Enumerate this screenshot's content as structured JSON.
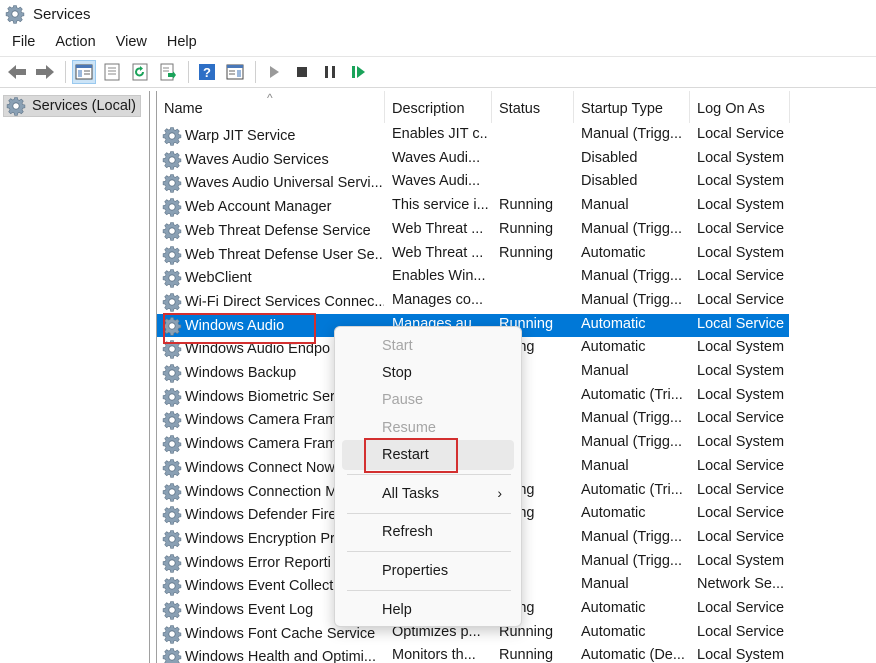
{
  "window": {
    "title": "Services"
  },
  "menu": [
    "File",
    "Action",
    "View",
    "Help"
  ],
  "tree": {
    "root": "Services (Local)"
  },
  "columns": [
    "Name",
    "Description",
    "Status",
    "Startup Type",
    "Log On As"
  ],
  "rows": [
    [
      "Warp JIT Service",
      "Enables JIT c...",
      "",
      "Manual (Trigg...",
      "Local Service"
    ],
    [
      "Waves Audio Services",
      "Waves Audi...",
      "",
      "Disabled",
      "Local System"
    ],
    [
      "Waves Audio Universal Servi...",
      "Waves Audi...",
      "",
      "Disabled",
      "Local System"
    ],
    [
      "Web Account Manager",
      "This service i...",
      "Running",
      "Manual",
      "Local System"
    ],
    [
      "Web Threat Defense Service",
      "Web Threat ...",
      "Running",
      "Manual (Trigg...",
      "Local Service"
    ],
    [
      "Web Threat Defense User Se...",
      "Web Threat ...",
      "Running",
      "Automatic",
      "Local System"
    ],
    [
      "WebClient",
      "Enables Win...",
      "",
      "Manual (Trigg...",
      "Local Service"
    ],
    [
      "Wi-Fi Direct Services Connec...",
      "Manages co...",
      "",
      "Manual (Trigg...",
      "Local Service"
    ],
    [
      "Windows Audio",
      "Manages au...",
      "Running",
      "Automatic",
      "Local Service"
    ],
    [
      "Windows Audio Endpo",
      "",
      "nning",
      "Automatic",
      "Local System"
    ],
    [
      "Windows Backup",
      "",
      "",
      "Manual",
      "Local System"
    ],
    [
      "Windows Biometric Ser",
      "",
      "",
      "Automatic (Tri...",
      "Local System"
    ],
    [
      "Windows Camera Fram",
      "",
      "",
      "Manual (Trigg...",
      "Local Service"
    ],
    [
      "Windows Camera Fram",
      "",
      "",
      "Manual (Trigg...",
      "Local System"
    ],
    [
      "Windows Connect Now",
      "",
      "",
      "Manual",
      "Local Service"
    ],
    [
      "Windows Connection M",
      "",
      "nning",
      "Automatic (Tri...",
      "Local Service"
    ],
    [
      "Windows Defender Fire",
      "",
      "nning",
      "Automatic",
      "Local Service"
    ],
    [
      "Windows Encryption Pr",
      "",
      "",
      "Manual (Trigg...",
      "Local Service"
    ],
    [
      "Windows Error Reporti",
      "",
      "",
      "Manual (Trigg...",
      "Local System"
    ],
    [
      "Windows Event Collect",
      "",
      "",
      "Manual",
      "Network Se..."
    ],
    [
      "Windows Event Log",
      "",
      "nning",
      "Automatic",
      "Local Service"
    ],
    [
      "Windows Font Cache Service",
      "Optimizes p...",
      "Running",
      "Automatic",
      "Local Service"
    ],
    [
      "Windows Health and Optimi...",
      "Monitors th...",
      "Running",
      "Automatic (De...",
      "Local System"
    ]
  ],
  "selected_row": "Windows Audio",
  "context_menu": {
    "items": [
      {
        "label": "Start",
        "enabled": false
      },
      {
        "label": "Stop",
        "enabled": true
      },
      {
        "label": "Pause",
        "enabled": false
      },
      {
        "label": "Resume",
        "enabled": false
      },
      {
        "label": "Restart",
        "enabled": true
      },
      {
        "label": "All Tasks",
        "enabled": true,
        "submenu": true
      },
      {
        "label": "Refresh",
        "enabled": true
      },
      {
        "label": "Properties",
        "enabled": true
      },
      {
        "label": "Help",
        "enabled": true
      }
    ]
  },
  "colors": {
    "selection": "#0078d7",
    "highlight_box": "#d32f2f",
    "toolbar_blue": "#2d6fc6",
    "play_green": "#1aa35a"
  },
  "icons": [
    "gear-icon",
    "back-arrow-icon",
    "forward-arrow-icon",
    "show-hide-tree-icon",
    "properties-icon",
    "refresh-icon",
    "export-list-icon",
    "help-icon",
    "show-action-pane-icon",
    "play-icon",
    "stop-icon",
    "pause-icon",
    "resume-icon",
    "chevron-right-icon"
  ]
}
